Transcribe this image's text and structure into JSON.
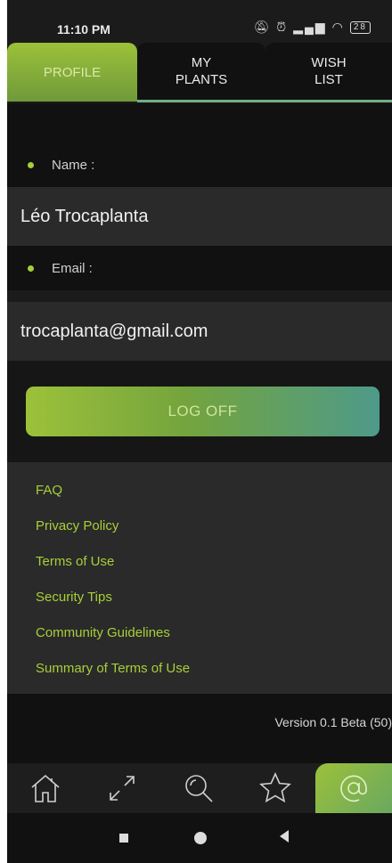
{
  "status_bar": {
    "time": "11:10 PM",
    "battery": "28",
    "icons": [
      "mute-icon",
      "alarm-icon",
      "signal-icon",
      "wifi-icon",
      "battery-icon"
    ]
  },
  "tabs": [
    {
      "label": "PROFILE",
      "active": true
    },
    {
      "label": "MY PLANTS",
      "active": false
    },
    {
      "label": "WISH LIST",
      "active": false
    }
  ],
  "profile": {
    "name_label": "Name :",
    "name_value": "Léo Trocaplanta",
    "email_label": "Email :",
    "email_value": "trocaplanta@gmail.com"
  },
  "logoff_label": "LOG OFF",
  "links": [
    "FAQ",
    "Privacy Policy",
    "Terms of Use",
    "Security Tips",
    "Community Guidelines",
    "Summary of Terms of Use"
  ],
  "version": "Version 0.1 Beta (50)",
  "bottom_nav": [
    {
      "icon": "home-icon",
      "active": false
    },
    {
      "icon": "swap-arrows-icon",
      "active": false
    },
    {
      "icon": "search-icon",
      "active": false
    },
    {
      "icon": "star-icon",
      "active": false
    },
    {
      "icon": "at-icon",
      "active": true
    }
  ],
  "colors": {
    "accent": "#a4cf3a",
    "gradient_start": "#9cc13a",
    "gradient_end": "#4e9a8a",
    "background": "#1b1b1b",
    "panel": "#2a2a2a"
  }
}
